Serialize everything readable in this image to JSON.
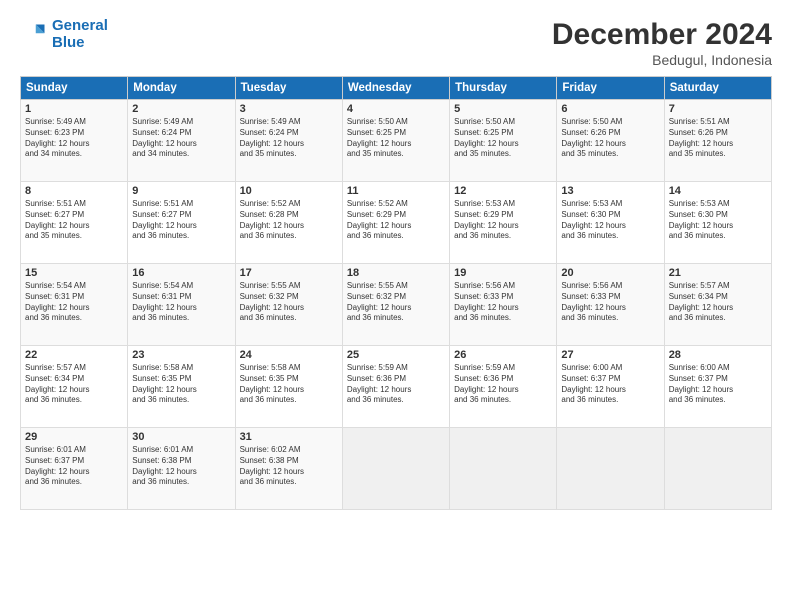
{
  "logo": {
    "line1": "General",
    "line2": "Blue"
  },
  "title": "December 2024",
  "subtitle": "Bedugul, Indonesia",
  "days_header": [
    "Sunday",
    "Monday",
    "Tuesday",
    "Wednesday",
    "Thursday",
    "Friday",
    "Saturday"
  ],
  "weeks": [
    [
      {
        "day": "1",
        "text": "Sunrise: 5:49 AM\nSunset: 6:23 PM\nDaylight: 12 hours\nand 34 minutes."
      },
      {
        "day": "2",
        "text": "Sunrise: 5:49 AM\nSunset: 6:24 PM\nDaylight: 12 hours\nand 34 minutes."
      },
      {
        "day": "3",
        "text": "Sunrise: 5:49 AM\nSunset: 6:24 PM\nDaylight: 12 hours\nand 35 minutes."
      },
      {
        "day": "4",
        "text": "Sunrise: 5:50 AM\nSunset: 6:25 PM\nDaylight: 12 hours\nand 35 minutes."
      },
      {
        "day": "5",
        "text": "Sunrise: 5:50 AM\nSunset: 6:25 PM\nDaylight: 12 hours\nand 35 minutes."
      },
      {
        "day": "6",
        "text": "Sunrise: 5:50 AM\nSunset: 6:26 PM\nDaylight: 12 hours\nand 35 minutes."
      },
      {
        "day": "7",
        "text": "Sunrise: 5:51 AM\nSunset: 6:26 PM\nDaylight: 12 hours\nand 35 minutes."
      }
    ],
    [
      {
        "day": "8",
        "text": "Sunrise: 5:51 AM\nSunset: 6:27 PM\nDaylight: 12 hours\nand 35 minutes."
      },
      {
        "day": "9",
        "text": "Sunrise: 5:51 AM\nSunset: 6:27 PM\nDaylight: 12 hours\nand 36 minutes."
      },
      {
        "day": "10",
        "text": "Sunrise: 5:52 AM\nSunset: 6:28 PM\nDaylight: 12 hours\nand 36 minutes."
      },
      {
        "day": "11",
        "text": "Sunrise: 5:52 AM\nSunset: 6:29 PM\nDaylight: 12 hours\nand 36 minutes."
      },
      {
        "day": "12",
        "text": "Sunrise: 5:53 AM\nSunset: 6:29 PM\nDaylight: 12 hours\nand 36 minutes."
      },
      {
        "day": "13",
        "text": "Sunrise: 5:53 AM\nSunset: 6:30 PM\nDaylight: 12 hours\nand 36 minutes."
      },
      {
        "day": "14",
        "text": "Sunrise: 5:53 AM\nSunset: 6:30 PM\nDaylight: 12 hours\nand 36 minutes."
      }
    ],
    [
      {
        "day": "15",
        "text": "Sunrise: 5:54 AM\nSunset: 6:31 PM\nDaylight: 12 hours\nand 36 minutes."
      },
      {
        "day": "16",
        "text": "Sunrise: 5:54 AM\nSunset: 6:31 PM\nDaylight: 12 hours\nand 36 minutes."
      },
      {
        "day": "17",
        "text": "Sunrise: 5:55 AM\nSunset: 6:32 PM\nDaylight: 12 hours\nand 36 minutes."
      },
      {
        "day": "18",
        "text": "Sunrise: 5:55 AM\nSunset: 6:32 PM\nDaylight: 12 hours\nand 36 minutes."
      },
      {
        "day": "19",
        "text": "Sunrise: 5:56 AM\nSunset: 6:33 PM\nDaylight: 12 hours\nand 36 minutes."
      },
      {
        "day": "20",
        "text": "Sunrise: 5:56 AM\nSunset: 6:33 PM\nDaylight: 12 hours\nand 36 minutes."
      },
      {
        "day": "21",
        "text": "Sunrise: 5:57 AM\nSunset: 6:34 PM\nDaylight: 12 hours\nand 36 minutes."
      }
    ],
    [
      {
        "day": "22",
        "text": "Sunrise: 5:57 AM\nSunset: 6:34 PM\nDaylight: 12 hours\nand 36 minutes."
      },
      {
        "day": "23",
        "text": "Sunrise: 5:58 AM\nSunset: 6:35 PM\nDaylight: 12 hours\nand 36 minutes."
      },
      {
        "day": "24",
        "text": "Sunrise: 5:58 AM\nSunset: 6:35 PM\nDaylight: 12 hours\nand 36 minutes."
      },
      {
        "day": "25",
        "text": "Sunrise: 5:59 AM\nSunset: 6:36 PM\nDaylight: 12 hours\nand 36 minutes."
      },
      {
        "day": "26",
        "text": "Sunrise: 5:59 AM\nSunset: 6:36 PM\nDaylight: 12 hours\nand 36 minutes."
      },
      {
        "day": "27",
        "text": "Sunrise: 6:00 AM\nSunset: 6:37 PM\nDaylight: 12 hours\nand 36 minutes."
      },
      {
        "day": "28",
        "text": "Sunrise: 6:00 AM\nSunset: 6:37 PM\nDaylight: 12 hours\nand 36 minutes."
      }
    ],
    [
      {
        "day": "29",
        "text": "Sunrise: 6:01 AM\nSunset: 6:37 PM\nDaylight: 12 hours\nand 36 minutes."
      },
      {
        "day": "30",
        "text": "Sunrise: 6:01 AM\nSunset: 6:38 PM\nDaylight: 12 hours\nand 36 minutes."
      },
      {
        "day": "31",
        "text": "Sunrise: 6:02 AM\nSunset: 6:38 PM\nDaylight: 12 hours\nand 36 minutes."
      },
      {
        "day": "",
        "text": ""
      },
      {
        "day": "",
        "text": ""
      },
      {
        "day": "",
        "text": ""
      },
      {
        "day": "",
        "text": ""
      }
    ]
  ]
}
